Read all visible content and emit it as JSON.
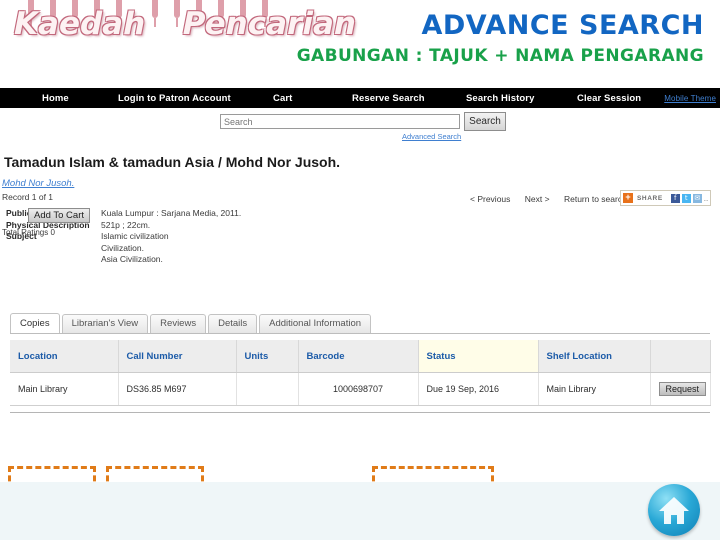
{
  "slide": {
    "wordart_title_part1": "Kaedah",
    "wordart_title_part2": "Pencarian",
    "headline_main": "ADVANCE SEARCH",
    "headline_sub": "GABUNGAN : TAJUK + NAMA PENGARANG",
    "colors": {
      "headline_main": "#1266c2",
      "headline_sub": "#19a14a",
      "wordart": "#c2687c",
      "highlight_box": "#e07b18",
      "link": "#3f7fd0",
      "table_header_text": "#1c5ba8"
    }
  },
  "navbar": {
    "home": "Home",
    "login": "Login to Patron Account",
    "cart": "Cart",
    "reserve_search": "Reserve Search",
    "search_history": "Search History",
    "clear_session": "Clear Session",
    "mobile_theme": "Mobile Theme"
  },
  "search": {
    "placeholder": "Search",
    "value": "",
    "button_label": "Search",
    "advanced_link": "Advanced Search"
  },
  "record": {
    "title": "Tamadun Islam & tamadun Asia / Mohd Nor Jusoh.",
    "author_link": "Mohd Nor Jusoh.",
    "record_count": "Record 1 of 1",
    "fields": [
      {
        "label": "Publication",
        "values": [
          "Kuala Lumpur : Sarjana Media, 2011."
        ]
      },
      {
        "label": "Physical Description",
        "values": [
          "521p ; 22cm."
        ]
      },
      {
        "label": "Subject",
        "values": [
          "Islamic civilization",
          "Civilization.",
          "Asia Civilization."
        ]
      }
    ],
    "add_to_cart": "Add To Cart",
    "total_ratings": "Total Ratings  0",
    "nav_previous": "< Previous",
    "nav_next": "Next >",
    "nav_return": "Return to search",
    "share": {
      "plus": "+",
      "label": "SHARE",
      "facebook_icon": "f",
      "twitter_icon": "t",
      "mail_icon": "✉",
      "more": ".."
    }
  },
  "tabs": [
    {
      "label": "Copies",
      "active": true
    },
    {
      "label": "Librarian's View",
      "active": false
    },
    {
      "label": "Reviews",
      "active": false
    },
    {
      "label": "Details",
      "active": false
    },
    {
      "label": "Additional Information",
      "active": false
    }
  ],
  "copies_table": {
    "headers": [
      "Location",
      "Call Number",
      "Units",
      "Barcode",
      "Status",
      "Shelf Location",
      ""
    ],
    "rows": [
      {
        "location": "Main Library",
        "call_number": "DS36.85 M697",
        "units": "",
        "barcode": "1000698707",
        "status": "Due 19 Sep, 2016",
        "shelf_location": "Main Library",
        "action": "Request"
      }
    ]
  },
  "footer": {
    "home_button_icon": "home-icon"
  }
}
